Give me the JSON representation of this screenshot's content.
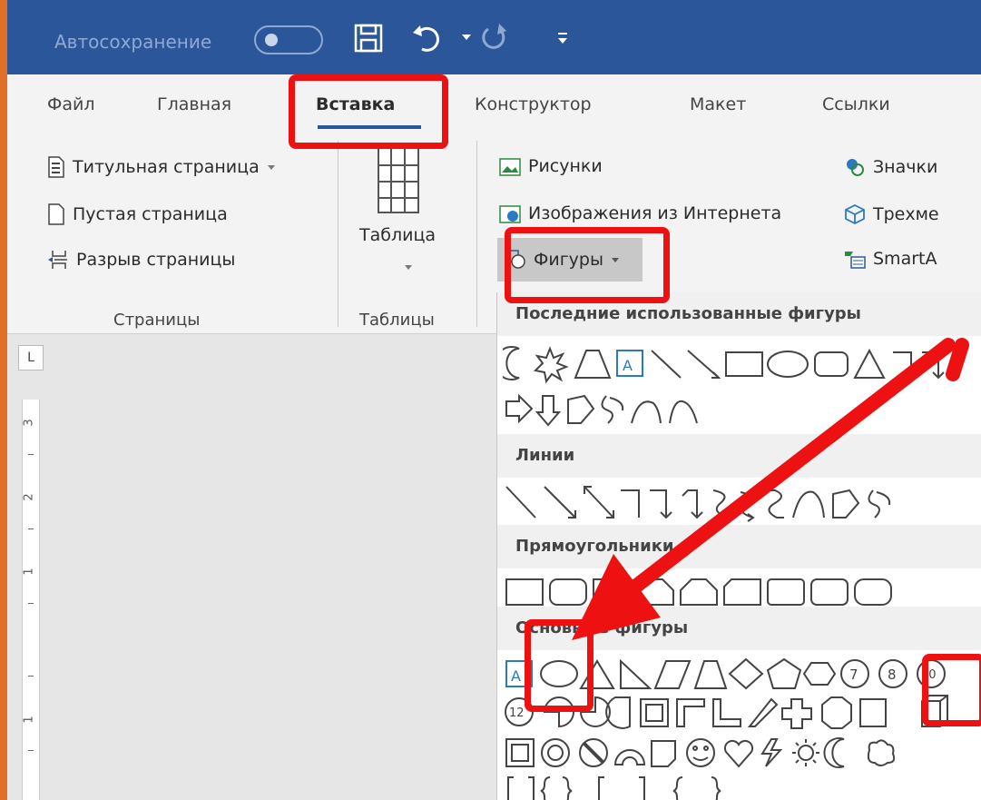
{
  "titlebar": {
    "autosave_label": "Автосохранение",
    "quick_access": [
      "save-icon",
      "undo-icon",
      "redo-icon",
      "customize-icon"
    ]
  },
  "tabs": [
    {
      "label": "Файл"
    },
    {
      "label": "Главная"
    },
    {
      "label": "Вставка",
      "active": true
    },
    {
      "label": "Конструктор"
    },
    {
      "label": "Макет"
    },
    {
      "label": "Ссылки"
    }
  ],
  "ribbon": {
    "pages": {
      "items": [
        "Титульная страница",
        "Пустая страница",
        "Разрыв страницы"
      ],
      "group_label": "Страницы"
    },
    "tables": {
      "button_label": "Таблица",
      "group_label": "Таблицы"
    },
    "illustrations": {
      "pictures": "Рисунки",
      "online_pictures": "Изображения из Интернета",
      "shapes": "Фигуры",
      "icons": "Значки",
      "models_3d": "Трехме",
      "smartart": "SmartA"
    }
  },
  "shapes_menu": {
    "recent_header": "Последние использованные фигуры",
    "lines_header": "Линии",
    "rectangles_header": "Прямоугольники",
    "basic_header": "Основные фигуры"
  },
  "colors": {
    "accent": "#2b579a",
    "highlight": "#ee1111",
    "orange_edge": "#e06f28"
  }
}
